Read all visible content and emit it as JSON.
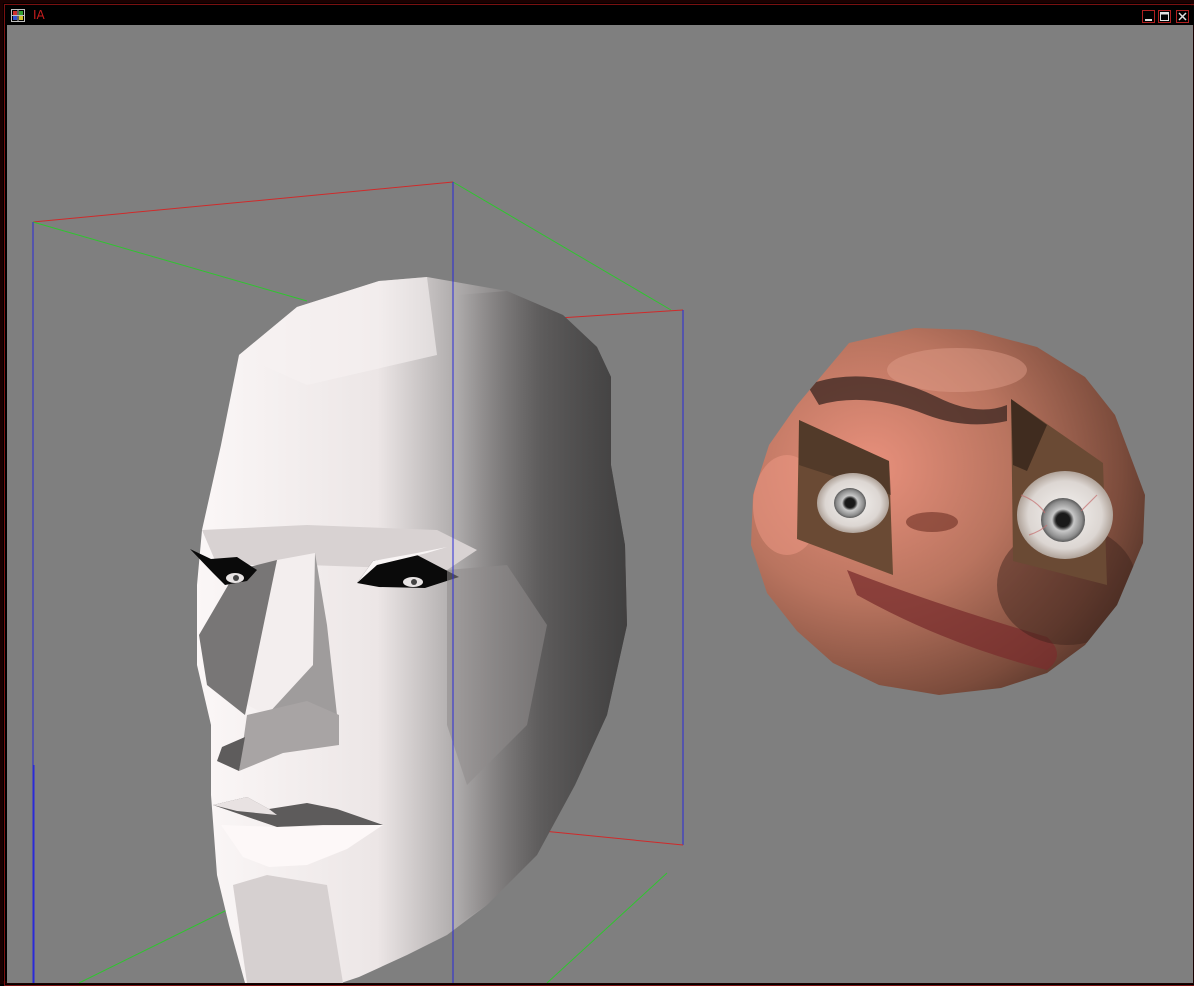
{
  "window": {
    "title": "IA",
    "app_icon": "grid-app-icon",
    "controls": [
      "minimize-icon",
      "maximize-icon",
      "close-icon"
    ]
  },
  "viewport": {
    "background_color": "#7f7f7f",
    "objects": [
      "shaded-head-model",
      "bounding-box",
      "textured-sphere"
    ]
  },
  "colors": {
    "title_text": "#c81e1e",
    "axis_x": "#d02a2a",
    "axis_y": "#2fc52f",
    "axis_z": "#2a2ad8",
    "skin": "#b87060"
  }
}
